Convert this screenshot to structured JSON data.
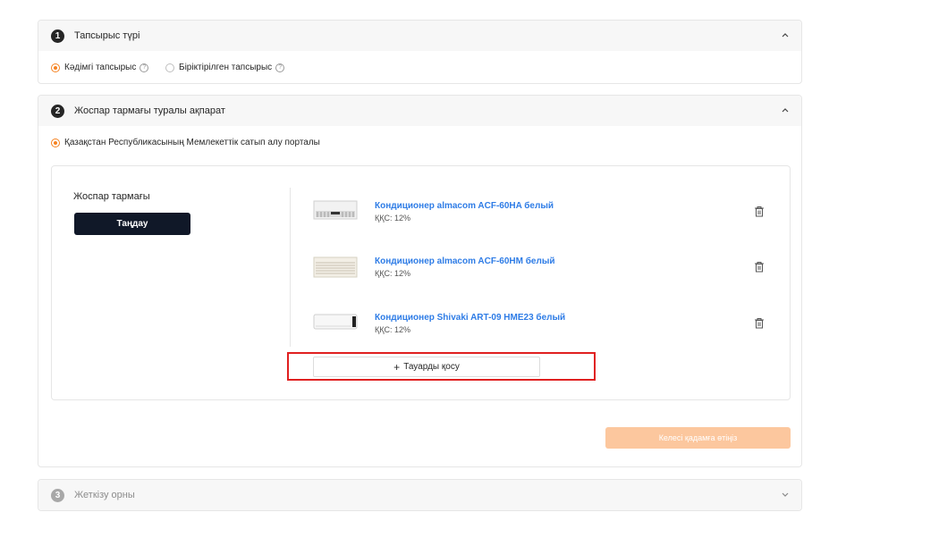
{
  "step1": {
    "number": "1",
    "title": "Тапсырыс түрі",
    "options": [
      {
        "label": "Кәдімгі тапсырыс",
        "checked": true
      },
      {
        "label": "Біріктірілген тапсырыс",
        "checked": false
      }
    ]
  },
  "step2": {
    "number": "2",
    "title": "Жоспар тармағы туралы ақпарат",
    "portal_option": "Қазақстан Республикасының Мемлекеттік сатып алу порталы",
    "plan_label": "Жоспар тармағы",
    "choose_button": "Таңдау",
    "products": [
      {
        "name": "Кондиционер almacom ACF-60HA белый",
        "vat": "ҚҚС: 12%"
      },
      {
        "name": "Кондиционер almacom ACF-60HM белый",
        "vat": "ҚҚС: 12%"
      },
      {
        "name": "Кондиционер Shivaki ART-09 HME23 белый",
        "vat": "ҚҚС: 12%"
      }
    ],
    "add_button": "Тауарды қосу",
    "next_button": "Келесі қадамға өтіңіз"
  },
  "step3": {
    "number": "3",
    "title": "Жеткізу орны"
  },
  "colors": {
    "accent": "#f58220",
    "link": "#2e7ce6",
    "dark_button": "#101828",
    "highlight": "#e02020"
  }
}
